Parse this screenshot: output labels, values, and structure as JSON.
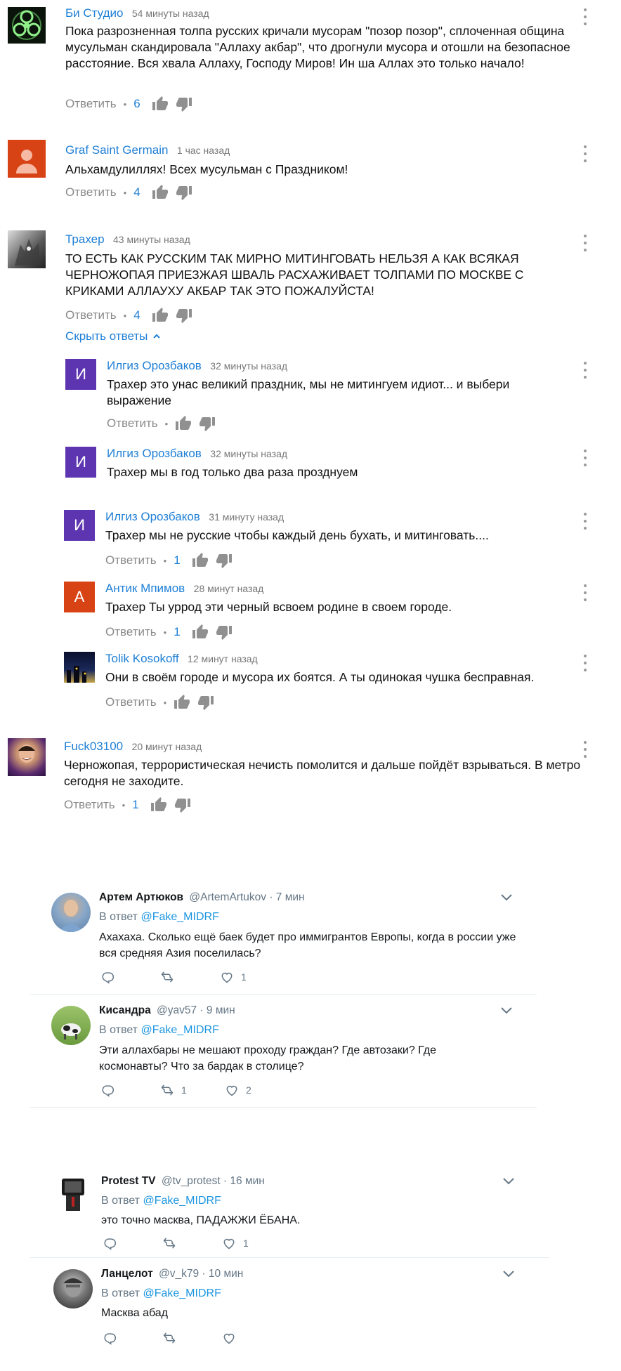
{
  "comments": [
    {
      "author": "Би Студио",
      "time": "54 минуты назад",
      "text": "Пока разрозненная толпа русских кричали мусорам \"позор позор\", сплоченная община мусульман скандировала \"Аллаху акбар\", что дрогнули мусора и отошли на безопасное расстояние. Вся хвала Аллаху, Господу Миров! Ин ша Аллах это только начало!",
      "reply_label": "Ответить",
      "likes": "6",
      "avatar_icon": "biohazard-icon"
    },
    {
      "author": "Graf Saint Germain",
      "time": "1 час назад",
      "text": "Альхамдулиллях! Всех мусульман с Праздником!",
      "reply_label": "Ответить",
      "likes": "4",
      "avatar_icon": "default-user-icon"
    },
    {
      "author": "Трахер",
      "time": "43 минуты назад",
      "text": "ТО ЕСТЬ КАК РУССКИМ ТАК МИРНО МИТИНГОВАТЬ НЕЛЬЗЯ А КАК ВСЯКАЯ ЧЕРНОЖОПАЯ ПРИЕЗЖАЯ ШВАЛЬ РАСХАЖИВАЕТ  ТОЛПАМИ ПО МОСКВЕ С КРИКАМИ АЛЛАУХУ АКБАР ТАК ЭТО ПОЖАЛУЙСТА!",
      "reply_label": "Ответить",
      "likes": "4",
      "hide_replies": "Скрыть ответы"
    },
    {
      "author": "Fuck03100",
      "time": "20 минут назад",
      "text": "Черножопая, террористическая нечисть помолится и дальше пойдёт взрываться. В метро сегодня не заходите.",
      "reply_label": "Ответить",
      "likes": "1"
    }
  ],
  "replies": [
    {
      "avatar_letter": "И",
      "author": "Илгиз Орозбаков",
      "time": "32 минуты назад",
      "text": "Трахер это унас великий праздник, мы не митингуем идиот... и выбери выражение",
      "reply_label": "Ответить",
      "likes": ""
    },
    {
      "avatar_letter": "И",
      "author": "Илгиз Орозбаков",
      "time": "32 минуты назад",
      "text": "Трахер мы в год только два раза прозднуем"
    },
    {
      "avatar_letter": "И",
      "author": "Илгиз Орозбаков",
      "time": "31 минуту назад",
      "text": "Трахер мы не русские чтобы каждый день бухать, и митинговать....",
      "reply_label": "Ответить",
      "likes": "1"
    },
    {
      "avatar_letter": "А",
      "author": "Антик Мпимов",
      "time": "28 минут назад",
      "text": "Трахер Ты уррод эти черный всвоем родине в своем городе.",
      "reply_label": "Ответить",
      "likes": "1"
    },
    {
      "author": "Tolik Kosokoff",
      "time": "12 минут назад",
      "text": "Они в своём городе и мусора их боятся. А ты одинокая чушка бесправная.",
      "reply_label": "Ответить",
      "likes": ""
    }
  ],
  "tweets": [
    {
      "name": "Артем Артюков",
      "handle": "@ArtemArtukov · 7 мин",
      "reply_prefix": "В ответ",
      "reply_to": "@Fake_MIDRF",
      "text": "Ахахаха. Сколько ещё баек будет про иммигрантов Европы, когда в россии уже вся средняя Азия поселилась?",
      "retweets": "",
      "likes": "1"
    },
    {
      "name": "Кисандра",
      "handle": "@yav57 · 9 мин",
      "reply_prefix": "В ответ",
      "reply_to": "@Fake_MIDRF",
      "text": "Эти аллахбары не мешают проходу граждан? Где автозаки? Где космонавты? Что за бардак в столице?",
      "retweets": "1",
      "likes": "2"
    },
    {
      "name": "Protest TV",
      "handle": "@tv_protest · 16 мин",
      "reply_prefix": "В ответ",
      "reply_to": "@Fake_MIDRF",
      "text": "это точно масква, ПАДАЖЖИ ЁБАНА.",
      "retweets": "",
      "likes": "1"
    },
    {
      "name": "Ланцелот",
      "handle": "@v_k79 · 10 мин",
      "reply_prefix": "В ответ",
      "reply_to": "@Fake_MIDRF",
      "text": "Масква абад",
      "retweets": "",
      "likes": ""
    }
  ],
  "colors": {
    "link_blue": "#1e7fd6",
    "twitter_blue": "#1b95e0",
    "avatar_purple": "#5e35b1",
    "avatar_orange": "#d84315",
    "avatar_red": "#d84315"
  }
}
